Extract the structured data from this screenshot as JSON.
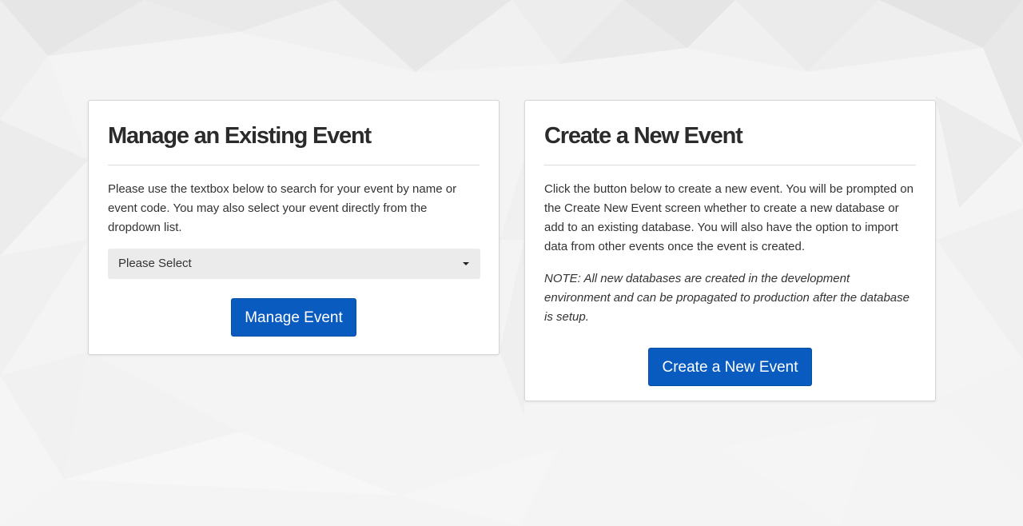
{
  "theme": {
    "accent": "#0a5bbf",
    "background": "#f5f5f5",
    "card_background": "#ffffff",
    "select_background": "#ebebeb"
  },
  "manage": {
    "title": "Manage an Existing Event",
    "description": "Please use the textbox below to search for your event by name or event code. You may also select your event directly from the dropdown list.",
    "select": {
      "selected": "Please Select",
      "icon": "caret-down-icon"
    },
    "button_label": "Manage Event"
  },
  "create": {
    "title": "Create a New Event",
    "description": "Click the button below to create a new event. You will be prompted on the Create New Event screen whether to create a new database or add to an existing database. You will also have the option to import data from other events once the event is created.",
    "note": "NOTE: All new databases are created in the development environment and can be propagated to production after the database is setup.",
    "button_label": "Create a New Event"
  }
}
